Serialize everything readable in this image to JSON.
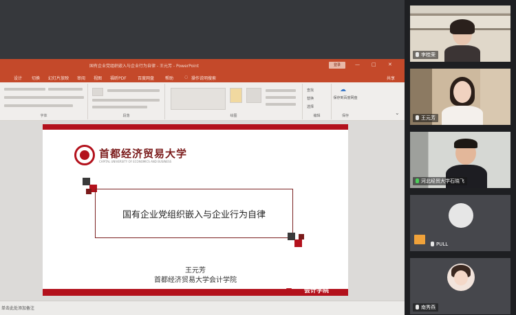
{
  "window": {
    "title": "国有企业党组织嵌入与企业行为自律 - 王元芳 - PowerPoint",
    "signin_label": "登录",
    "win_min": "—",
    "win_max": "□",
    "win_close": "✕"
  },
  "menu": {
    "items": [
      "设计",
      "切换",
      "幻灯片放映",
      "审阅",
      "视图",
      "福昕PDF",
      "百度网盘",
      "帮助",
      "操作说明搜索"
    ],
    "share": "共享"
  },
  "ribbon": {
    "groups": [
      "字体",
      "段落",
      "绘图",
      "编辑"
    ],
    "editing_items": [
      "查找",
      "替换",
      "选择"
    ],
    "save_label": "保存到百度网盘",
    "save_group": "保存"
  },
  "slide": {
    "university_name": "首都经济贸易大学",
    "university_sub": "CAPITAL UNIVERSITY OF ECONOMICS AND BUSINESS",
    "title": "国有企业党组织嵌入与企业行为自律",
    "author": "王元芳",
    "school": "首都经济贸易大学会计学院",
    "footer_logo": "会计学院"
  },
  "statusbar": {
    "notes_placeholder": "单击此处添加备注"
  },
  "participants": [
    {
      "name": "李桂荣",
      "mic": "white"
    },
    {
      "name": "王元芳",
      "mic": "white"
    },
    {
      "name": "河北经贸大学石晓飞",
      "mic": "green"
    },
    {
      "name": "PULL",
      "mic": "white"
    },
    {
      "name": "南秀燕",
      "mic": "white"
    }
  ],
  "colors": {
    "accent_red": "#b3111c",
    "ppt_orange": "#c4492a",
    "panel_bg": "#1e1f22"
  }
}
